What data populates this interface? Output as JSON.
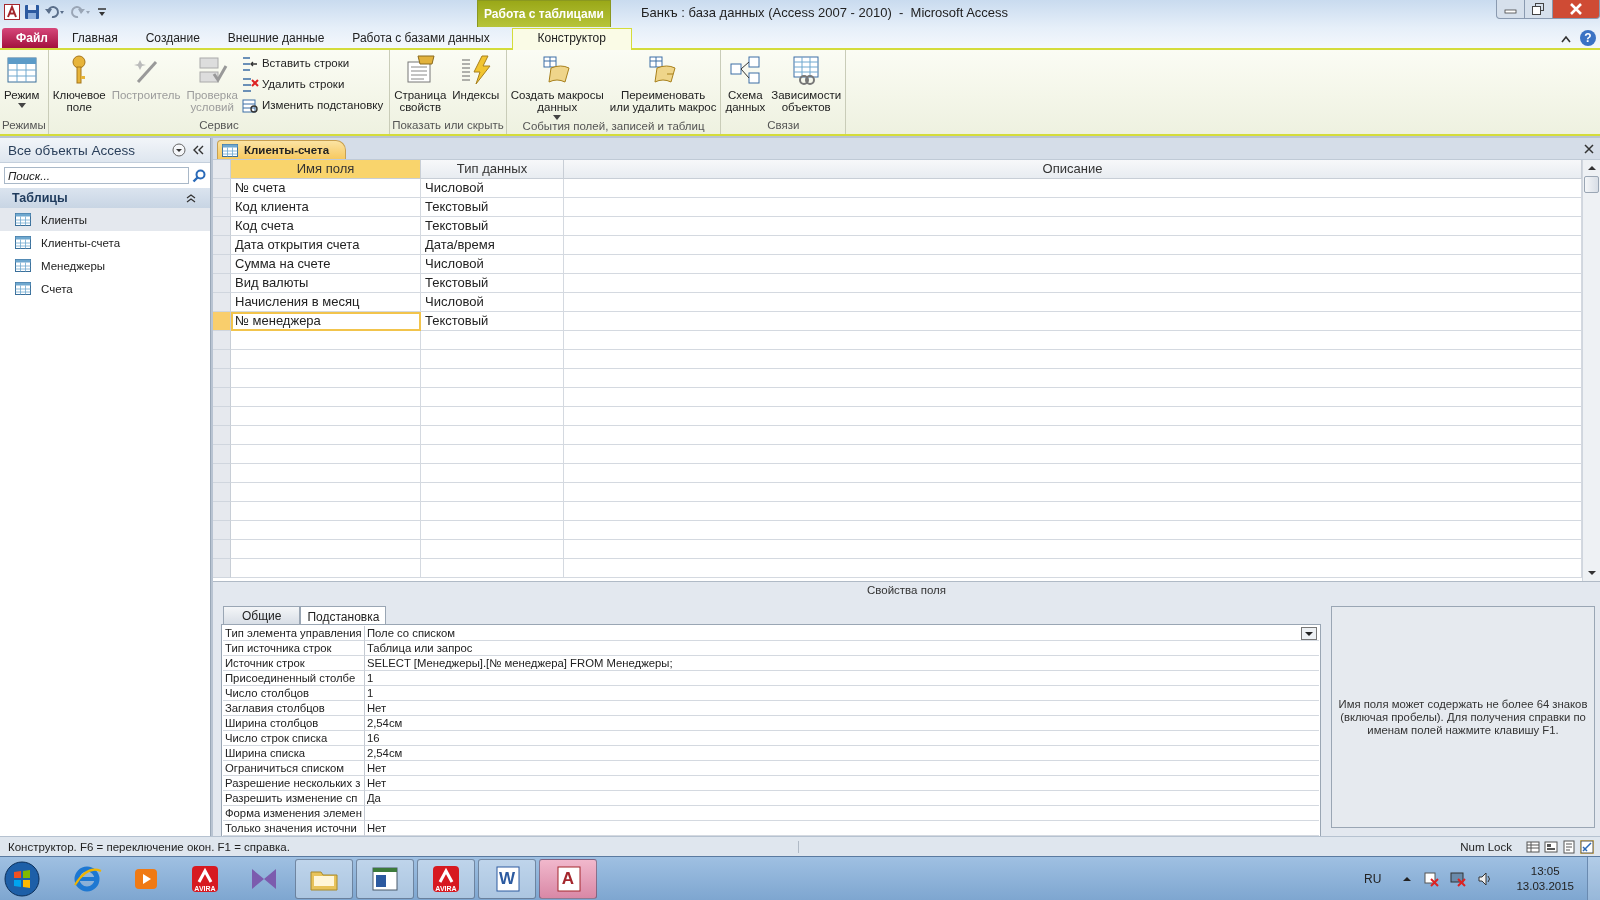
{
  "window": {
    "title": "Банкъ : база данных (Access 2007 - 2010)  -  Microsoft Access",
    "context_tab": "Работа с таблицами"
  },
  "ribbon_tabs": [
    {
      "label": "Файл",
      "kind": "file",
      "selected": false
    },
    {
      "label": "Главная",
      "kind": "tab",
      "selected": false
    },
    {
      "label": "Создание",
      "kind": "tab",
      "selected": false
    },
    {
      "label": "Внешние данные",
      "kind": "tab",
      "selected": false
    },
    {
      "label": "Работа с базами данных",
      "kind": "tab",
      "selected": false
    },
    {
      "label": "Конструктор",
      "kind": "context",
      "selected": true
    }
  ],
  "help_glyph": "?",
  "ribbon_groups": [
    {
      "label": "Режимы",
      "commands": [
        {
          "label": "Режим",
          "kind": "large",
          "disabled": false,
          "dropdown": true
        }
      ]
    },
    {
      "label": "Сервис",
      "commands": [
        {
          "label": "Ключевое\nполе",
          "kind": "large",
          "disabled": false,
          "dropdown": false
        },
        {
          "label": "Построитель",
          "kind": "large",
          "disabled": true,
          "dropdown": false
        },
        {
          "label": "Проверка\nусловий",
          "kind": "large",
          "disabled": true,
          "dropdown": false
        },
        {
          "label": "Вставить строки",
          "kind": "small",
          "disabled": false
        },
        {
          "label": "Удалить строки",
          "kind": "small",
          "disabled": false
        },
        {
          "label": "Изменить подстановку",
          "kind": "small",
          "disabled": false
        }
      ]
    },
    {
      "label": "Показать или скрыть",
      "commands": [
        {
          "label": "Страница\nсвойств",
          "kind": "large",
          "disabled": false,
          "dropdown": false
        },
        {
          "label": "Индексы",
          "kind": "large",
          "disabled": false,
          "dropdown": false
        }
      ]
    },
    {
      "label": "События полей, записей и таблиц",
      "commands": [
        {
          "label": "Создать макросы\nданных",
          "kind": "large",
          "disabled": false,
          "dropdown": true
        },
        {
          "label": "Переименовать\nили удалить макрос",
          "kind": "large",
          "disabled": false,
          "dropdown": false
        }
      ]
    },
    {
      "label": "Связи",
      "commands": [
        {
          "label": "Схема\nданных",
          "kind": "large",
          "disabled": false,
          "dropdown": false
        },
        {
          "label": "Зависимости\nобъектов",
          "kind": "large",
          "disabled": false,
          "dropdown": false
        }
      ]
    }
  ],
  "nav_pane": {
    "title": "Все объекты Access",
    "search": {
      "placeholder": "Поиск..."
    },
    "group": "Таблицы",
    "items": [
      {
        "label": "Клиенты",
        "selected": true
      },
      {
        "label": "Клиенты-счета",
        "selected": false
      },
      {
        "label": "Менеджеры",
        "selected": false
      },
      {
        "label": "Счета",
        "selected": false
      }
    ]
  },
  "document_tab": "Клиенты-счета",
  "design_grid": {
    "columns": [
      "Имя поля",
      "Тип данных",
      "Описание"
    ],
    "rows": [
      {
        "field": "№ счета",
        "type": "Числовой",
        "selected": false
      },
      {
        "field": "Код клиента",
        "type": "Текстовый",
        "selected": false
      },
      {
        "field": "Код счета",
        "type": "Текстовый",
        "selected": false
      },
      {
        "field": "Дата открытия счета",
        "type": "Дата/время",
        "selected": false
      },
      {
        "field": "Сумма на счете",
        "type": "Числовой",
        "selected": false
      },
      {
        "field": "Вид валюты",
        "type": "Текстовый",
        "selected": false
      },
      {
        "field": "Начисления в месяц",
        "type": "Числовой",
        "selected": false
      },
      {
        "field": "№ менеджера",
        "type": "Текстовый",
        "selected": true
      }
    ]
  },
  "field_properties": {
    "title": "Свойства поля",
    "tabs": [
      {
        "label": "Общие",
        "selected": false
      },
      {
        "label": "Подстановка",
        "selected": true
      }
    ],
    "properties": [
      {
        "label": "Тип элемента управления",
        "value": "Поле со списком",
        "dropdown": true
      },
      {
        "label": "Тип источника строк",
        "value": "Таблица или запрос",
        "dropdown": false
      },
      {
        "label": "Источник строк",
        "value": "SELECT [Менеджеры].[№ менеджера] FROM Менеджеры;",
        "dropdown": false
      },
      {
        "label": "Присоединенный столбе",
        "value": "1",
        "dropdown": false
      },
      {
        "label": "Число столбцов",
        "value": "1",
        "dropdown": false
      },
      {
        "label": "Заглавия столбцов",
        "value": "Нет",
        "dropdown": false
      },
      {
        "label": "Ширина столбцов",
        "value": "2,54см",
        "dropdown": false
      },
      {
        "label": "Число строк списка",
        "value": "16",
        "dropdown": false
      },
      {
        "label": "Ширина списка",
        "value": "2,54см",
        "dropdown": false
      },
      {
        "label": "Ограничиться списком",
        "value": "Нет",
        "dropdown": false
      },
      {
        "label": "Разрешение нескольких з",
        "value": "Нет",
        "dropdown": false
      },
      {
        "label": "Разрешить изменение сп",
        "value": "Да",
        "dropdown": false
      },
      {
        "label": "Форма изменения элемен",
        "dropdown": false
      },
      {
        "label": "Только значения источни",
        "value": "Нет",
        "dropdown": false
      }
    ],
    "help_text": "Имя поля может содержать не более 64 знаков (включая пробелы). Для получения справки по именам полей нажмите клавишу F1."
  },
  "status_bar": {
    "text": "Конструктор.  F6 = переключение окон.  F1 = справка.",
    "num_lock": "Num Lock"
  },
  "taskbar": {
    "apps": [
      {
        "kind": "ie",
        "selected": false
      },
      {
        "kind": "media",
        "selected": false
      },
      {
        "kind": "avira",
        "label": "AVIRA",
        "selected": false
      },
      {
        "kind": "vs",
        "selected": false
      },
      {
        "kind": "folder",
        "selected": false
      },
      {
        "kind": "window",
        "selected": false
      },
      {
        "kind": "avira",
        "label": "AVIRA",
        "selected": false
      },
      {
        "kind": "word",
        "label": "W",
        "selected": false
      },
      {
        "kind": "access",
        "label": "A",
        "selected": true
      }
    ],
    "language": "RU",
    "time": "13:05",
    "date": "13.03.2015"
  }
}
